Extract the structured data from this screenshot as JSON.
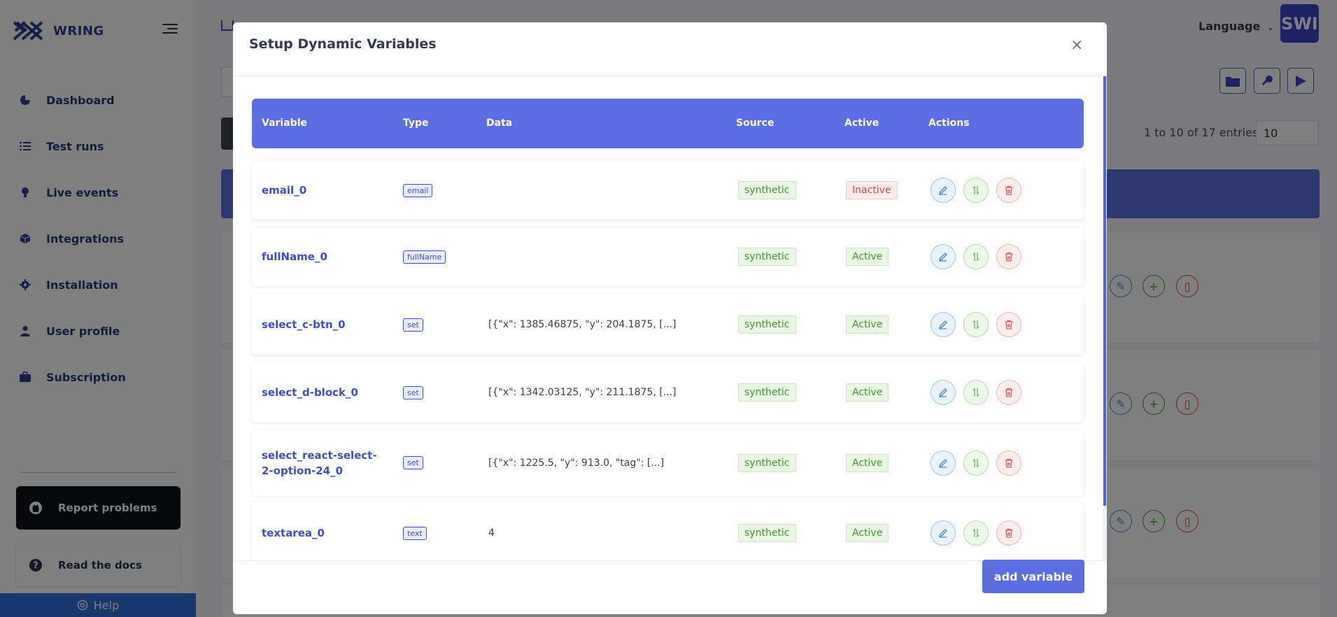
{
  "app": {
    "brand_name": "WRING",
    "language_label": "Language",
    "avatar_text": "SWI",
    "entries_text": "1 to 10 of 17 entries",
    "page_size_value": "10"
  },
  "sidebar": {
    "items": [
      {
        "label": "Dashboard",
        "icon": "pie-chart-icon"
      },
      {
        "label": "Test runs",
        "icon": "list-icon"
      },
      {
        "label": "Live events",
        "icon": "lightbulb-icon"
      },
      {
        "label": "Integrations",
        "icon": "cube-icon"
      },
      {
        "label": "Installation",
        "icon": "gear-icon"
      },
      {
        "label": "User profile",
        "icon": "user-icon"
      },
      {
        "label": "Subscription",
        "icon": "briefcase-icon"
      }
    ],
    "report_label": "Report problems",
    "docs_label": "Read the docs",
    "help_label": "Help"
  },
  "modal": {
    "title": "Setup Dynamic Variables",
    "close_symbol": "×",
    "add_button_label": "add variable",
    "columns": [
      "Variable",
      "Type",
      "Data",
      "Source",
      "Active",
      "Actions"
    ],
    "rows": [
      {
        "variable": "email_0",
        "type": "email",
        "data": "",
        "source": "synthetic",
        "active": "Inactive"
      },
      {
        "variable": "fullName_0",
        "type": "fullName",
        "data": "",
        "source": "synthetic",
        "active": "Active"
      },
      {
        "variable": "select_c-btn_0",
        "type": "set",
        "data": "[{\"x\": 1385.46875, \"y\": 204.1875, [...]",
        "source": "synthetic",
        "active": "Active"
      },
      {
        "variable": "select_d-block_0",
        "type": "set",
        "data": "[{\"x\": 1342.03125, \"y\": 211.1875, [...]",
        "source": "synthetic",
        "active": "Active"
      },
      {
        "variable": "select_react-select-2-option-24_0",
        "type": "set",
        "data": "[{\"x\": 1225.5, \"y\": 913.0, \"tag\": [...]",
        "source": "synthetic",
        "active": "Active"
      },
      {
        "variable": "textarea_0",
        "type": "text",
        "data": "4",
        "source": "synthetic",
        "active": "Active"
      }
    ]
  },
  "colors": {
    "accent": "#5b6ee1",
    "active_green": "#3f9a2a",
    "inactive_red": "#d94343",
    "sidebar_dark": "#0f1012",
    "help_blue": "#2f71d6"
  }
}
